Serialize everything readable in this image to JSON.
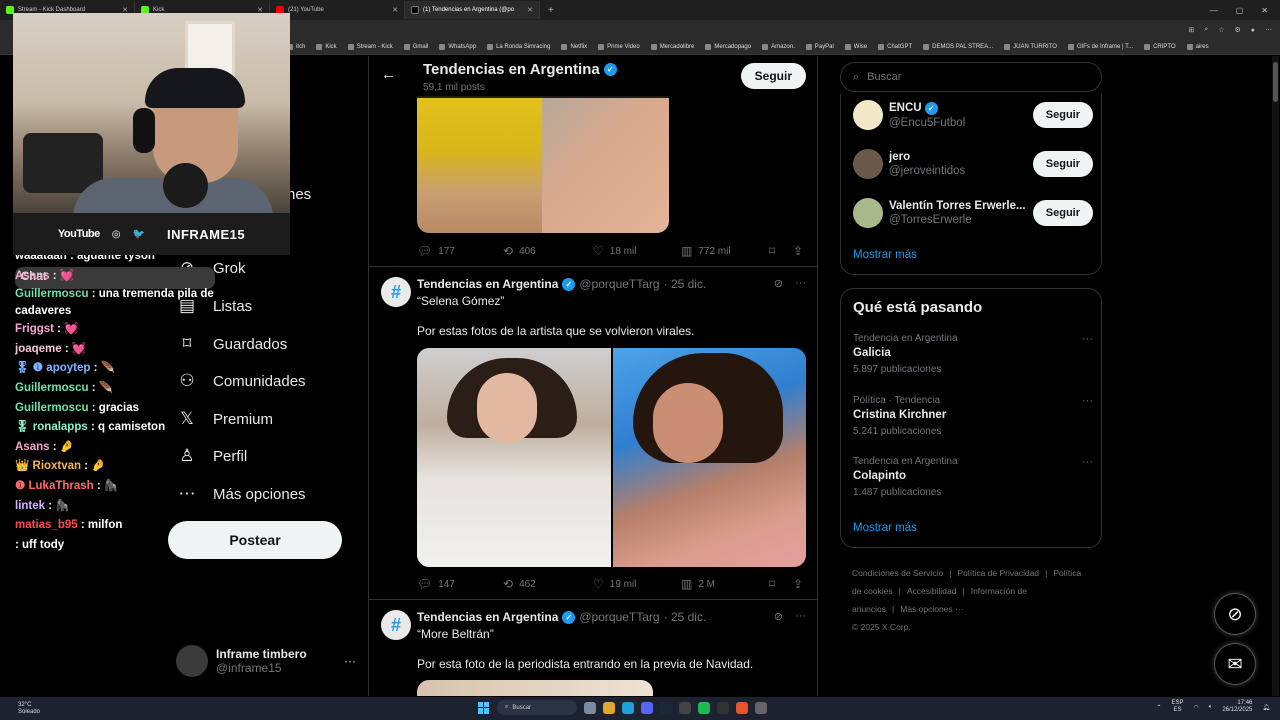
{
  "browser": {
    "tabs": [
      {
        "label": "Stream - Kick Dashboard",
        "icon": "kick"
      },
      {
        "label": "Kick",
        "icon": "kick"
      },
      {
        "label": "(21) YouTube",
        "icon": "youtube"
      },
      {
        "label": "(1) Tendencias en Argentina (@po",
        "icon": "x",
        "active": true
      }
    ],
    "new_tab": "+",
    "bookmarks": [
      "itch",
      "Kick",
      "Stream - Kick",
      "Gmail",
      "WhatsApp",
      "La Ronda Simracing",
      "Netflix",
      "Prime Video",
      "Mercadolibre",
      "Mercadopago",
      "Amazon.",
      "PayPal",
      "Wise",
      "ChatGPT",
      "DEMOS PAL STREA...",
      "JUAN TURRITO",
      "GIFs de Inframe | T...",
      "CRIPTO",
      "aires"
    ],
    "chat_button": "Chat"
  },
  "webcam": {
    "youtube": "YouTube",
    "channel_name": "INFRAME15"
  },
  "chat": [
    {
      "user": "waaataan",
      "msg": " : aguante tyson",
      "color": "#ffffff"
    },
    {
      "user": "Asans",
      "msg": " : 💓",
      "color": "#f4a8d0"
    },
    {
      "user": "Guillermoscu",
      "msg": " : una tremenda pila de cadaveres",
      "color": "#6fe2a8",
      "wrap": true
    },
    {
      "user": "Friggst",
      "msg": " : 💓",
      "color": "#f4a8d0"
    },
    {
      "user": "joaqeme",
      "msg": " : 💓",
      "color": "#f7c4d9"
    },
    {
      "user": "🎖 ❶ apoytep",
      "msg": " : 🪶",
      "color": "#7db6ff"
    },
    {
      "user": "Guillermoscu",
      "msg": " : 🪶",
      "color": "#6fe2a8"
    },
    {
      "user": "Guillermoscu",
      "msg": " : gracias",
      "color": "#6fe2a8"
    },
    {
      "user": "🎖 ronalapps",
      "msg": " : q camiseton",
      "color": "#8ef0c8"
    },
    {
      "user": "Asans",
      "msg": " : 🤌",
      "color": "#f4a8d0"
    },
    {
      "user": "👑 Rioxtvan",
      "msg": " : 🤌",
      "color": "#f6b55a"
    },
    {
      "user": "❶ LukaThrash",
      "msg": " : 🦍",
      "color": "#ff6b6b"
    },
    {
      "user": "lintek",
      "msg": " : 🦍",
      "color": "#d3b4ff"
    },
    {
      "user": "matias_b95",
      "msg": " : milfon",
      "color": "#ff4d4d"
    },
    {
      "user": "",
      "msg": ": uff tody",
      "color": "#ffffff"
    }
  ],
  "nav": {
    "partial_label": "nes",
    "items": [
      {
        "label": "Grok",
        "icon": "grok-icon"
      },
      {
        "label": "Listas",
        "icon": "list-icon"
      },
      {
        "label": "Guardados",
        "icon": "bookmark-icon"
      },
      {
        "label": "Comunidades",
        "icon": "communities-icon"
      },
      {
        "label": "Premium",
        "icon": "x-logo-icon"
      },
      {
        "label": "Perfil",
        "icon": "profile-icon"
      },
      {
        "label": "Más opciones",
        "icon": "more-icon"
      }
    ],
    "post_button": "Postear",
    "account": {
      "name": "Inframe timbero",
      "handle": "@inframe15",
      "more": "···"
    }
  },
  "main": {
    "title": "Tendencias en Argentina",
    "subtitle": "59,1 mil posts",
    "follow": "Seguir",
    "first_actions": {
      "replies": "177",
      "reposts": "406",
      "likes": "18 mil",
      "views": "772 mil"
    },
    "tweets": [
      {
        "name": "Tendencias en Argentina",
        "handle": "@porqueTTarg",
        "date": "· 25 dic.",
        "quote": "“Selena Gómez”",
        "text": "Por estas fotos de la artista que se volvieron virales.",
        "actions": {
          "replies": "147",
          "reposts": "462",
          "likes": "19 mil",
          "views": "2 M"
        }
      },
      {
        "name": "Tendencias en Argentina",
        "handle": "@porqueTTarg",
        "date": "· 25 dic.",
        "quote": "“More Beltrán”",
        "text": "Por esta foto de la periodista entrando en la previa de Navidad."
      }
    ]
  },
  "right": {
    "search_placeholder": "Buscar",
    "who_to_follow": [
      {
        "name": "ENCU",
        "handle": "@Encu5Futbol",
        "verified": true,
        "button": "Seguir"
      },
      {
        "name": "jero",
        "handle": "@jeroveintidos",
        "verified": false,
        "button": "Seguir"
      },
      {
        "name": "Valentín Torres Erwerle...",
        "handle": "@TorresErwerle",
        "verified": false,
        "button": "Seguir"
      }
    ],
    "show_more": "Mostrar más",
    "trends_title": "Qué está pasando",
    "trends": [
      {
        "category": "Tendencia en Argentina",
        "title": "Galicia",
        "count": "5.897 publicaciones"
      },
      {
        "category": "Política · Tendencia",
        "title": "Cristina Kirchner",
        "count": "5.241 publicaciones"
      },
      {
        "category": "Tendencia en Argentina",
        "title": "Colapinto",
        "count": "1.487 publicaciones"
      }
    ],
    "trends_more": "Mostrar más",
    "footer": [
      "Condiciones de Servicio",
      "|",
      "Política de Privacidad",
      "|",
      "Política de cookies",
      "|",
      "Accesibilidad",
      "|",
      "Información de anuncios",
      "|",
      "Más opciones ···",
      "© 2025 X Corp."
    ]
  },
  "taskbar": {
    "temp": "32°C",
    "weather": "Soleado",
    "search": "Buscar",
    "lang1": "ESP",
    "lang2": "ES",
    "time": "17:46",
    "date": "26/12/2025"
  }
}
